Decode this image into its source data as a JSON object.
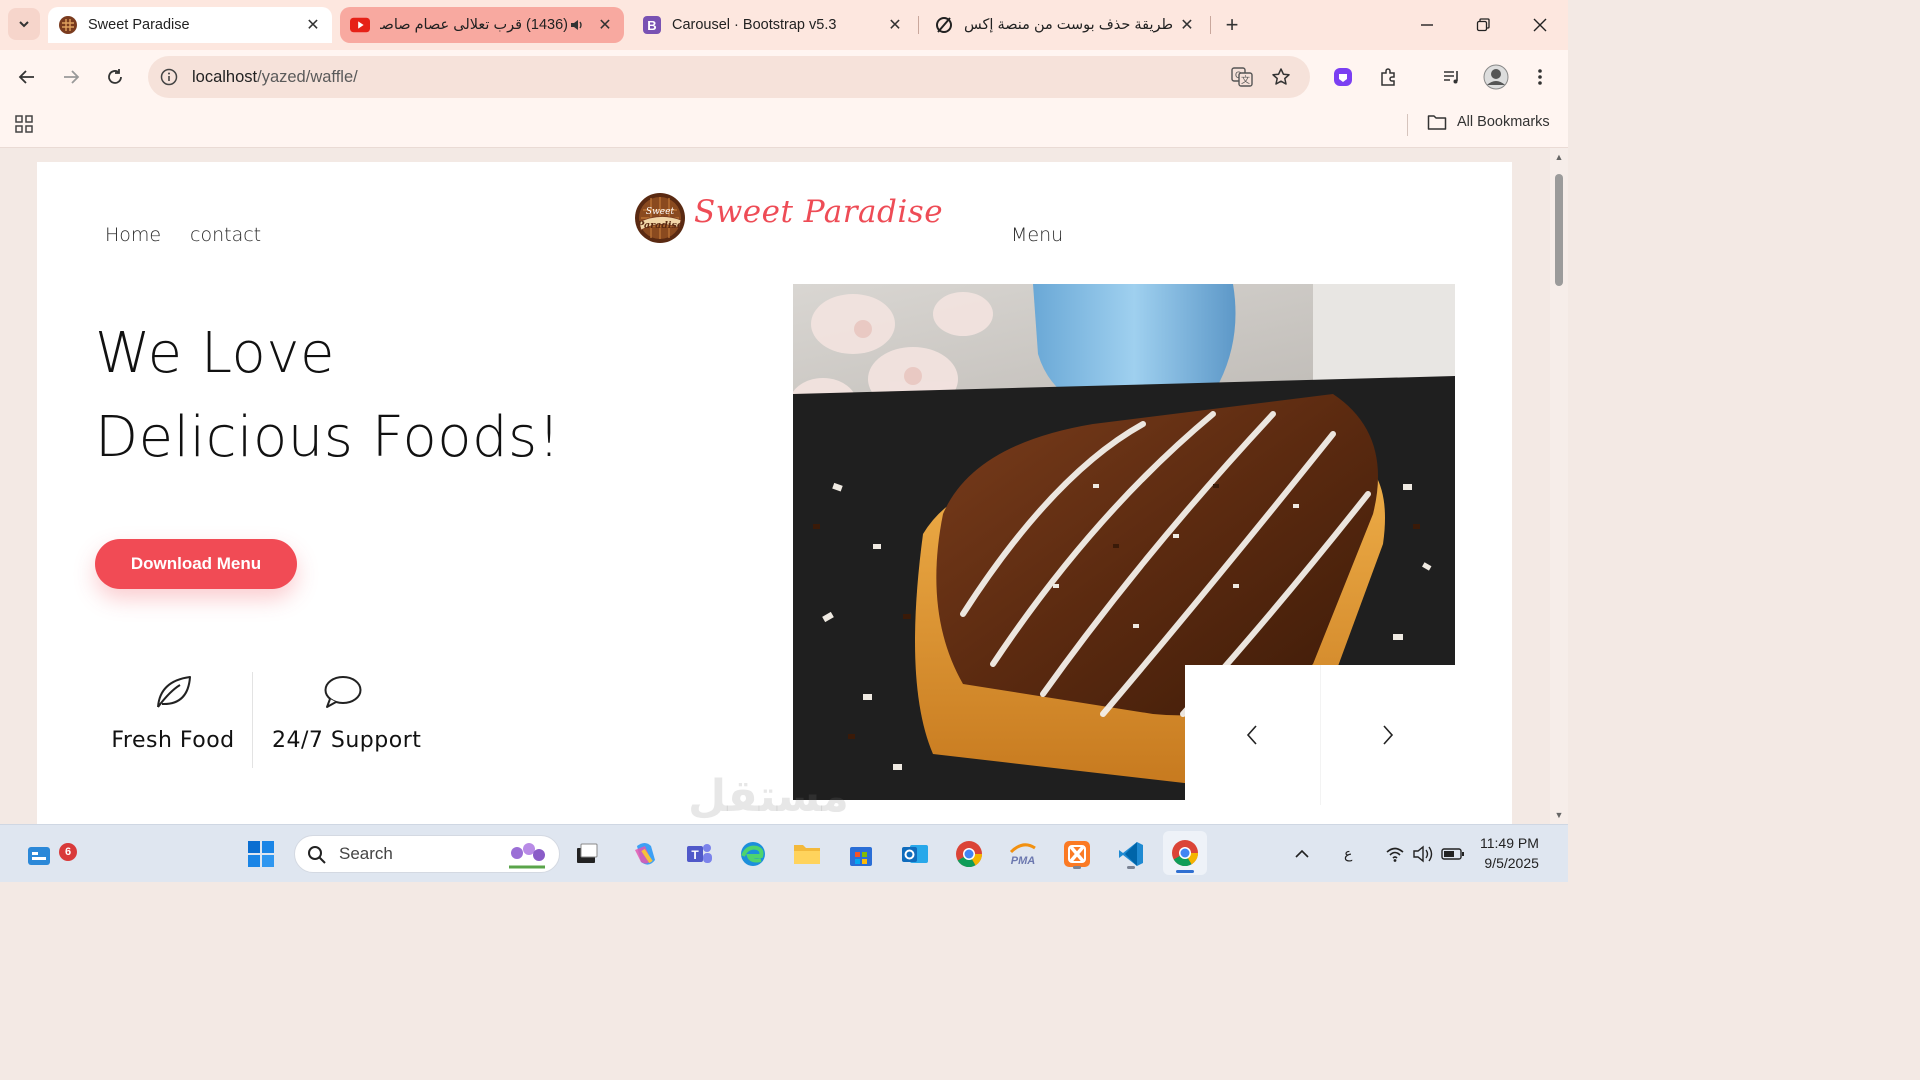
{
  "browser": {
    "tabs": [
      {
        "title": "Sweet Paradise",
        "favicon": "waffle-favicon-icon",
        "active": true
      },
      {
        "title": "(1436) قرب تعلالى عصام صاصا",
        "favicon": "youtube-icon",
        "audio": true
      },
      {
        "title": "Carousel · Bootstrap v5.3",
        "favicon": "bootstrap-icon"
      },
      {
        "title": "طريقة حذف بوست من منصة إكس",
        "favicon": "x-circle-icon"
      }
    ],
    "url_host": "localhost",
    "url_path": "/yazed/waffle/",
    "bookmarks_label": "All Bookmarks"
  },
  "site": {
    "nav": {
      "home": "Home",
      "contact": "contact",
      "menu": "Menu"
    },
    "brand": {
      "name": "Sweet Paradise",
      "logo_text_1": "Sweet",
      "logo_text_2": "Paradise"
    },
    "hero": {
      "line1": "We Love",
      "line2": "Delicious Foods!",
      "cta": "Download Menu"
    },
    "features": [
      {
        "label": "Fresh Food",
        "icon": "leaf-icon"
      },
      {
        "label": "24/7 Support",
        "icon": "chat-bubble-icon"
      }
    ],
    "carousel": {
      "prev": "prev-arrow-icon",
      "next": "next-arrow-icon"
    }
  },
  "taskbar": {
    "search_placeholder": "Search",
    "notification_count": "6",
    "input_language": "ع",
    "time": "11:49 PM",
    "date": "9/5/2025"
  },
  "watermark": "مستقل",
  "colors": {
    "accent": "#f14b55",
    "brand": "#ee4c56",
    "tabstrip": "#fde7df"
  }
}
